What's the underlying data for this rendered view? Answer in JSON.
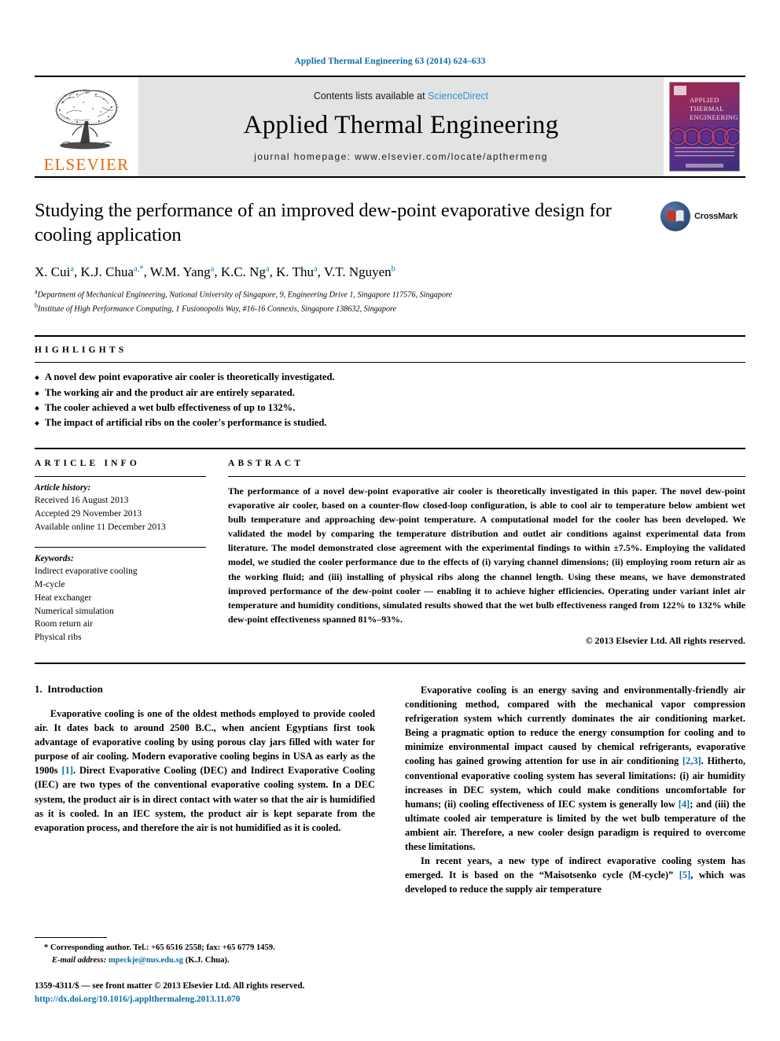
{
  "running_head": "Applied Thermal Engineering 63 (2014) 624–633",
  "masthead": {
    "publisher_wordmark": "ELSEVIER",
    "contents_prefix": "Contents lists available at ",
    "contents_link": "ScienceDirect",
    "journal_title": "Applied Thermal Engineering",
    "homepage": "journal homepage: www.elsevier.com/locate/apthermeng",
    "cover_title_line1": "APPLIED",
    "cover_title_line2": "THERMAL",
    "cover_title_line3": "ENGINEERING"
  },
  "article": {
    "title": "Studying the performance of an improved dew-point evaporative design for cooling application",
    "crossmark_label": "CrossMark",
    "authors_html": "X. Cui<sup>a</sup>, K.J. Chua<sup>a,*</sup>, W.M. Yang<sup>a</sup>, K.C. Ng<sup>a</sup>, K. Thu<sup>a</sup>, V.T. Nguyen<sup>b</sup>",
    "affiliation_a": "Department of Mechanical Engineering, National University of Singapore, 9, Engineering Drive 1, Singapore 117576, Singapore",
    "affiliation_b": "Institute of High Performance Computing, 1 Fusionopolis Way, #16-16 Connexis, Singapore 138632, Singapore"
  },
  "highlights": {
    "label": "HIGHLIGHTS",
    "items": [
      "A novel dew point evaporative air cooler is theoretically investigated.",
      "The working air and the product air are entirely separated.",
      "The cooler achieved a wet bulb effectiveness of up to 132%.",
      "The impact of artificial ribs on the cooler's performance is studied."
    ]
  },
  "article_info": {
    "label": "ARTICLE INFO",
    "history_heading": "Article history:",
    "history": [
      "Received 16 August 2013",
      "Accepted 29 November 2013",
      "Available online 11 December 2013"
    ],
    "keywords_heading": "Keywords:",
    "keywords": [
      "Indirect evaporative cooling",
      "M-cycle",
      "Heat exchanger",
      "Numerical simulation",
      "Room return air",
      "Physical ribs"
    ]
  },
  "abstract": {
    "label": "ABSTRACT",
    "text": "The performance of a novel dew-point evaporative air cooler is theoretically investigated in this paper. The novel dew-point evaporative air cooler, based on a counter-flow closed-loop configuration, is able to cool air to temperature below ambient wet bulb temperature and approaching dew-point temperature. A computational model for the cooler has been developed. We validated the model by comparing the temperature distribution and outlet air conditions against experimental data from literature. The model demonstrated close agreement with the experimental findings to within ±7.5%. Employing the validated model, we studied the cooler performance due to the effects of (i) varying channel dimensions; (ii) employing room return air as the working fluid; and (iii) installing of physical ribs along the channel length. Using these means, we have demonstrated improved performance of the dew-point cooler — enabling it to achieve higher efficiencies. Operating under variant inlet air temperature and humidity conditions, simulated results showed that the wet bulb effectiveness ranged from 122% to 132% while dew-point effectiveness spanned 81%–93%.",
    "copyright": "© 2013 Elsevier Ltd. All rights reserved."
  },
  "body": {
    "section_number": "1.",
    "section_title": "Introduction",
    "left_paragraph_1_pre": "Evaporative cooling is one of the oldest methods employed to provide cooled air. It dates back to around 2500 B.C., when ancient Egyptians first took advantage of evaporative cooling by using porous clay jars filled with water for purpose of air cooling. Modern evaporative cooling begins in USA as early as the 1900s ",
    "left_paragraph_1_ref": "[1]",
    "left_paragraph_1_post": ". Direct Evaporative Cooling (DEC) and Indirect Evaporative Cooling (IEC) are two types of the conventional evaporative cooling system. In a DEC system, the product air is in direct contact with water so that the air is humidified as it is cooled. In an IEC system, the product air is kept separate from the evaporation process, and therefore the air is not humidified as it is cooled.",
    "right_paragraph_1_pre": "Evaporative cooling is an energy saving and environmentally-friendly air conditioning method, compared with the mechanical vapor compression refrigeration system which currently dominates the air conditioning market. Being a pragmatic option to reduce the energy consumption for cooling and to minimize environmental impact caused by chemical refrigerants, evaporative cooling has gained growing attention for use in air conditioning ",
    "right_paragraph_1_ref1": "[2,3]",
    "right_paragraph_1_mid": ". Hitherto, conventional evaporative cooling system has several limitations: (i) air humidity increases in DEC system, which could make conditions uncomfortable for humans; (ii) cooling effectiveness of IEC system is generally low ",
    "right_paragraph_1_ref2": "[4]",
    "right_paragraph_1_post": "; and (iii) the ultimate cooled air temperature is limited by the wet bulb temperature of the ambient air. Therefore, a new cooler design paradigm is required to overcome these limitations.",
    "right_paragraph_2_pre": "In recent years, a new type of indirect evaporative cooling system has emerged. It is based on the “Maisotsenko cycle (M-cycle)” ",
    "right_paragraph_2_ref": "[5]",
    "right_paragraph_2_post": ", which was developed to reduce the supply air temperature"
  },
  "footer": {
    "corresponding_marker": "*",
    "corresponding_text": "Corresponding author. Tel.: +65 6516 2558; fax: +65 6779 1459.",
    "email_label": "E-mail address:",
    "email": "mpeckje@nus.edu.sg",
    "email_owner": "(K.J. Chua).",
    "issn_line": "1359-4311/$ — see front matter © 2013 Elsevier Ltd. All rights reserved.",
    "doi": "http://dx.doi.org/10.1016/j.applthermaleng.2013.11.070"
  },
  "colors": {
    "link_blue": "#0b6ea8",
    "sciencedirect_blue": "#2a93d5",
    "elsevier_orange": "#eb6608",
    "band_grey": "#e3e3e3"
  }
}
